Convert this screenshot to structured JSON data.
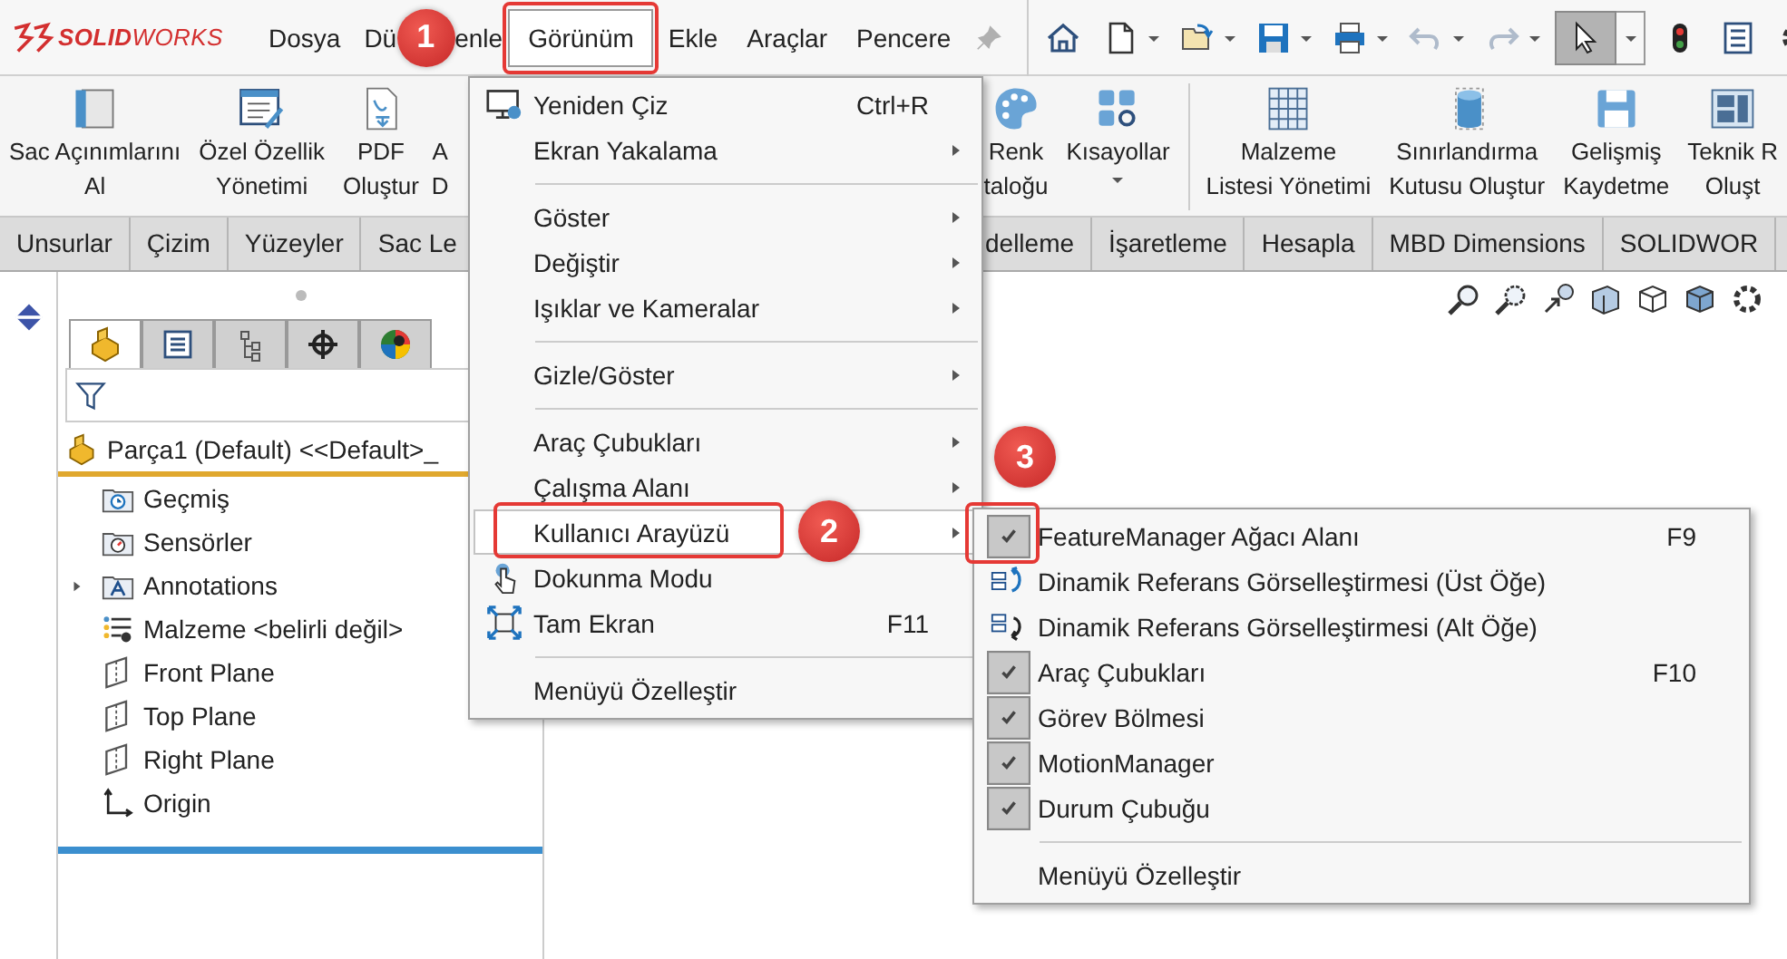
{
  "title_bar": {
    "logo": "**SOLID**WORKS"
  },
  "menu_bar": [
    {
      "label": "Dosya",
      "selected": false
    },
    {
      "parts": [
        "Dü",
        "enle"
      ],
      "selected": false
    },
    {
      "label": "Görünüm",
      "selected": true
    },
    {
      "label": "Ekle",
      "selected": false
    },
    {
      "label": "Araçlar",
      "selected": false
    },
    {
      "label": "Pencere",
      "selected": false
    }
  ],
  "quick_toolbar": [
    {
      "kind": "home",
      "dropdown": false,
      "disabled": false,
      "pressed": false
    },
    {
      "kind": "new",
      "dropdown": true,
      "disabled": false,
      "pressed": false
    },
    {
      "kind": "open",
      "dropdown": true,
      "disabled": false,
      "pressed": false
    },
    {
      "kind": "save",
      "dropdown": true,
      "disabled": false,
      "pressed": false
    },
    {
      "kind": "print",
      "dropdown": true,
      "disabled": false,
      "pressed": false
    },
    {
      "kind": "undo",
      "dropdown": true,
      "disabled": true,
      "pressed": false
    },
    {
      "kind": "redo",
      "dropdown": true,
      "disabled": true,
      "pressed": false
    },
    {
      "kind": "select",
      "dropdown": true,
      "disabled": false,
      "pressed": true
    },
    {
      "kind": "rebuild",
      "dropdown": false,
      "disabled": false,
      "pressed": false
    },
    {
      "kind": "list",
      "dropdown": false,
      "disabled": false,
      "pressed": false
    },
    {
      "kind": "gear",
      "dropdown": false,
      "disabled": false,
      "pressed": false
    }
  ],
  "ribbon": {
    "left": [
      {
        "kind": "flatten",
        "lines": [
          "Sac Açınımlarını",
          "Al"
        ],
        "dropdown": false
      },
      {
        "kind": "properties",
        "lines": [
          "Özel Özellik",
          "Yönetimi"
        ],
        "dropdown": false
      },
      {
        "kind": "pdf",
        "lines": [
          "PDF",
          "Oluştur"
        ],
        "dropdown": false
      },
      {
        "kind": "covered",
        "lines": [
          "A",
          "D"
        ],
        "dropdown": false
      }
    ],
    "right": [
      {
        "kind": "palette",
        "lines": [
          "Renk",
          "taloğu"
        ],
        "dropdown": false
      },
      {
        "kind": "shortcuts",
        "lines": [
          "Kısayollar"
        ],
        "dropdown": true
      },
      {
        "kind": "table",
        "lines": [
          "Malzeme",
          "Listesi Yönetimi"
        ],
        "dropdown": false
      },
      {
        "kind": "cylinder",
        "lines": [
          "Sınırlandırma",
          "Kutusu Oluştur"
        ],
        "dropdown": false
      },
      {
        "kind": "save",
        "lines": [
          "Gelişmiş",
          "Kaydetme"
        ],
        "dropdown": false
      },
      {
        "kind": "drawing",
        "lines": [
          "Teknik R",
          "Oluşt"
        ],
        "dropdown": false
      }
    ]
  },
  "command_tabs": {
    "left": [
      "Unsurlar",
      "Çizim",
      "Yüzeyler",
      "Sac Le"
    ],
    "right": [
      "delleme",
      "İşaretleme",
      "Hesapla",
      "MBD Dimensions",
      "SOLIDWOR"
    ]
  },
  "feature_manager": {
    "tabs": [
      {
        "kind": "part",
        "selected": true
      },
      {
        "kind": "property",
        "selected": false
      },
      {
        "kind": "config",
        "selected": false
      },
      {
        "kind": "crosshair",
        "selected": false
      },
      {
        "kind": "display",
        "selected": false
      }
    ],
    "root": "Parça1 (Default) <<Default>_",
    "items": [
      {
        "kind": "history",
        "label": "Geçmiş",
        "expandable": false
      },
      {
        "kind": "sensor",
        "label": "Sensörler",
        "expandable": false
      },
      {
        "kind": "annotations",
        "label": "Annotations",
        "expandable": true
      },
      {
        "kind": "material",
        "label": "Malzeme <belirli değil>",
        "expandable": false
      },
      {
        "kind": "plane",
        "label": "Front Plane",
        "expandable": false
      },
      {
        "kind": "plane",
        "label": "Top Plane",
        "expandable": false
      },
      {
        "kind": "plane",
        "label": "Right Plane",
        "expandable": false
      },
      {
        "kind": "origin",
        "label": "Origin",
        "expandable": false
      }
    ]
  },
  "view_menu": [
    {
      "kind": "redraw",
      "label": "Yeniden Çiz",
      "shortcut": "Ctrl+R",
      "submenu": false,
      "highlighted": false
    },
    {
      "kind": "item",
      "label": "Ekran Yakalama",
      "submenu": true,
      "highlighted": false
    },
    {
      "kind": "separator"
    },
    {
      "kind": "item",
      "label": "Göster",
      "submenu": true,
      "highlighted": false
    },
    {
      "kind": "item",
      "label": "Değiştir",
      "submenu": true,
      "highlighted": false
    },
    {
      "kind": "item",
      "label": "Işıklar ve Kameralar",
      "submenu": true,
      "highlighted": false
    },
    {
      "kind": "separator"
    },
    {
      "kind": "item",
      "label": "Gizle/Göster",
      "submenu": true,
      "highlighted": false
    },
    {
      "kind": "separator"
    },
    {
      "kind": "item",
      "label": "Araç Çubukları",
      "submenu": true,
      "highlighted": false
    },
    {
      "kind": "item",
      "label": "Çalışma Alanı",
      "submenu": true,
      "highlighted": false
    },
    {
      "kind": "item",
      "label": "Kullanıcı Arayüzü",
      "submenu": true,
      "highlighted": true
    },
    {
      "kind": "touch",
      "label": "Dokunma Modu",
      "submenu": false,
      "highlighted": false
    },
    {
      "kind": "fullscreen",
      "label": "Tam Ekran",
      "shortcut": "F11",
      "submenu": false,
      "highlighted": false
    },
    {
      "kind": "separator"
    },
    {
      "kind": "item",
      "label": "Menüyü Özelleştir",
      "submenu": false,
      "highlighted": false
    }
  ],
  "ui_submenu": [
    {
      "kind": "item",
      "label": "FeatureManager Ağacı Alanı",
      "shortcut": "F9",
      "checked": true
    },
    {
      "kind": "parent-ref",
      "label": "Dinamik Referans Görselleştirmesi (Üst Öğe)",
      "checked": false
    },
    {
      "kind": "child-ref",
      "label": "Dinamik Referans Görselleştirmesi (Alt Öğe)",
      "checked": false
    },
    {
      "kind": "item",
      "label": "Araç Çubukları",
      "shortcut": "F10",
      "checked": true
    },
    {
      "kind": "item",
      "label": "Görev Bölmesi",
      "checked": true
    },
    {
      "kind": "item",
      "label": "MotionManager",
      "checked": true
    },
    {
      "kind": "item",
      "label": "Durum Çubuğu",
      "checked": true
    },
    {
      "kind": "separator"
    },
    {
      "kind": "item",
      "label": "Menüyü Özelleştir",
      "checked": false
    }
  ],
  "callouts": [
    {
      "number": "1"
    },
    {
      "number": "2"
    },
    {
      "number": "3"
    }
  ]
}
